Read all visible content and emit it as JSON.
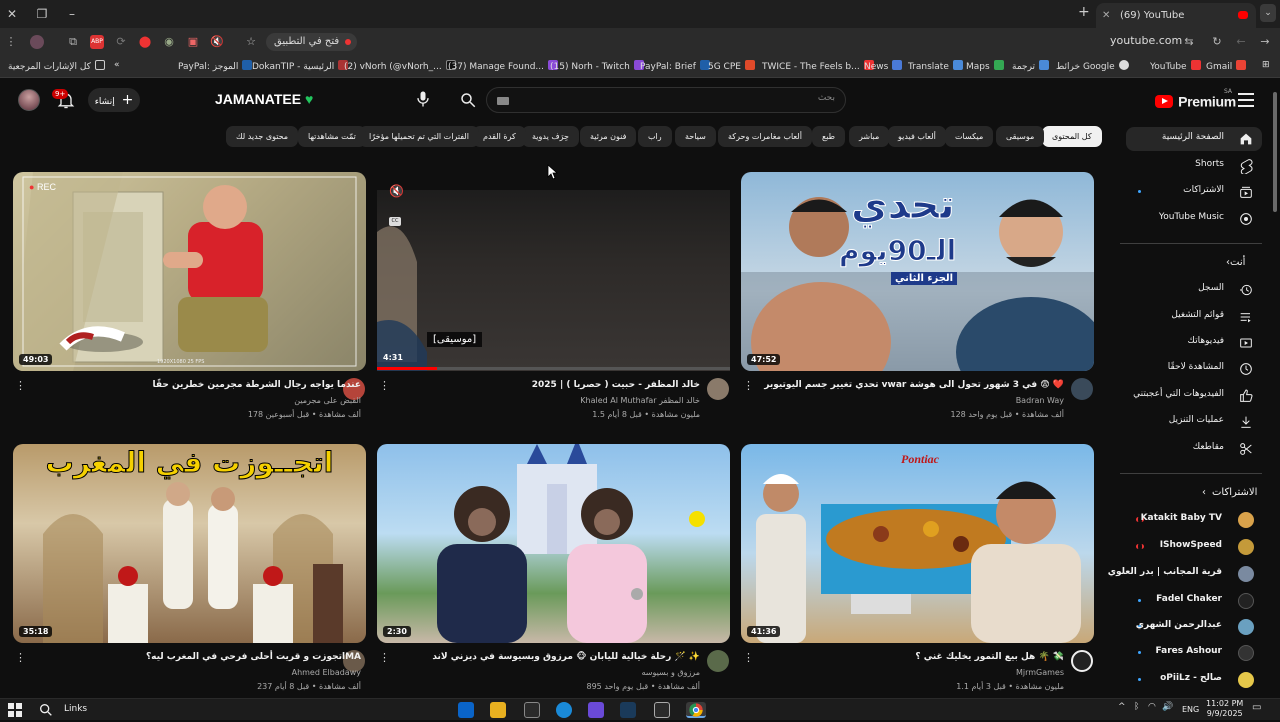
{
  "browser": {
    "tab_title": "(69) YouTube",
    "url": "youtube.com",
    "open_in_app": "فتح في التطبيق",
    "bookmarks": [
      "كل الإشارات المرجعية",
      "PayPal: الموجز",
      "DokanTIP - الرئيسية",
      "(2) vNorh (@vNorh_...",
      "(37) Manage Found...",
      "(15) Norh - Twitch",
      "PayPal: Brief",
      "5G CPE",
      "TWICE - The Feels b...",
      "News",
      "Translate",
      "Maps",
      "ترجمة",
      "خرائط Google",
      "YouTube",
      "Gmail"
    ]
  },
  "header": {
    "logo_text": "Premium",
    "logo_region": "SA",
    "search_placeholder": "بحث",
    "channel_name": "JAMANATEE",
    "channel_heart": "♥",
    "create_label": "إنشاء",
    "notification_count": "9+"
  },
  "chips": [
    "كل المحتوى",
    "موسيقى",
    "ميكسات",
    "ألعاب فيديو",
    "مباشر",
    "طبع",
    "ألعاب مغامرات وحركة",
    "سياحة",
    "راب",
    "فنون مرئية",
    "حِرَف يدوية",
    "كرة القدم",
    "الفترات التي تم تحميلها مؤخرًا",
    "تمّت مشاهدتها",
    "محتوى جديد لك"
  ],
  "sidebar": {
    "main": [
      {
        "label": "الصفحة الرئيسية",
        "icon": "home-icon"
      },
      {
        "label": "Shorts",
        "icon": "shorts-icon"
      },
      {
        "label": "الاشتراكات",
        "icon": "subscriptions-icon"
      },
      {
        "label": "YouTube Music",
        "icon": "music-icon"
      }
    ],
    "you_section": "أنت",
    "you_items": [
      {
        "label": "السجل",
        "icon": "history-icon"
      },
      {
        "label": "قوائم التشغيل",
        "icon": "playlists-icon"
      },
      {
        "label": "فيديوهاتك",
        "icon": "your-videos-icon"
      },
      {
        "label": "المشاهدة لاحقًا",
        "icon": "watch-later-icon"
      },
      {
        "label": "الفيديوهات التي أعجبتني",
        "icon": "like-icon"
      },
      {
        "label": "عمليات التنزيل",
        "icon": "download-icon"
      },
      {
        "label": "مقاطعك",
        "icon": "clips-icon"
      }
    ],
    "subs_section": "الاشتراكات",
    "subs": [
      {
        "label": "Katakit Baby TV",
        "color": "#d9a24b",
        "indicator": "live"
      },
      {
        "label": "IShowSpeed",
        "color": "#c49a3a",
        "indicator": "live"
      },
      {
        "label": "قرية المجانب | بدر العلوي",
        "color": "#7a8aa0",
        "indicator": "none"
      },
      {
        "label": "Fadel Chaker",
        "color": "#222222",
        "indicator": "dot"
      },
      {
        "label": "عبدالرحمن الشهري",
        "color": "#6aa0c0",
        "indicator": "dot"
      },
      {
        "label": "Fares Ashour",
        "color": "#333333",
        "indicator": "dot"
      },
      {
        "label": "oPiiLz - صالح",
        "color": "#e6c84a",
        "indicator": "dot"
      }
    ]
  },
  "videos": [
    {
      "title": "عندما يواجه رجال الشرطة مجرمين خطرين حقًا",
      "channel": "القبض على مجرمين",
      "meta": "178 ألف مشاهدة • قبل أسبوعين",
      "duration": "49:03",
      "avatar_color": "#b5443a"
    },
    {
      "title": "خالد المظفر - حبيت ( حصريا ) | 2025",
      "channel": "Khaled Al Muthafar  خالد المظفر",
      "meta": "1.5 مليون مشاهدة • قبل 8 أيام",
      "duration": "4:31",
      "overlay": "[موسيقى]",
      "avatar_color": "#8a7a6a"
    },
    {
      "title": "تحدي تغيير جسم اليوتيوبر vwar في 3 شهور تحول الى هوشة 😨 ❤️",
      "channel": "Badran Way",
      "meta": "128 ألف مشاهدة • قبل يوم واحد",
      "duration": "47:52",
      "avatar_color": "#3a4a5a"
    },
    {
      "title": "اتجوزت و قريت أحلى فرحي في المغرب ليه؟MA",
      "channel": "Ahmed Elbadawy",
      "meta": "237 ألف مشاهدة • قبل 8 أيام",
      "duration": "35:18",
      "avatar_color": "#6a5a4a"
    },
    {
      "title": "رحلة خيالية لليابان 🐵 مرزوق وبسيوسة في ديزني لاند 🪄 ✨",
      "channel": "مرزوق و بسيوسه",
      "meta": "895 ألف مشاهدة • قبل يوم واحد",
      "duration": "2:30",
      "avatar_color": "#5a6a4a"
    },
    {
      "title": "هل بيع التمور يخليك غني ؟ 🌴 💸",
      "channel": "MjrmGames",
      "meta": "1.1 مليون مشاهدة • قبل 3 أيام",
      "duration": "41:36",
      "avatar_color": "#222222"
    }
  ],
  "thumb_text": {
    "rec": "REC",
    "resolution": "1920X1080 25 FPS",
    "challenge_title": "تحدي",
    "challenge_days": "الـ90يوم",
    "challenge_part": "الجزء الثاني",
    "morocco": "اتجــوزت في المغرب",
    "pontiac": "Pontiac",
    "cc": "CC"
  },
  "taskbar": {
    "links_label": "Links",
    "language": "ENG",
    "time": "11:02 PM",
    "date": "9/9/2025"
  },
  "colors": {
    "accent": "#ff0000",
    "background": "#0f0f0f",
    "chip": "#272727"
  }
}
